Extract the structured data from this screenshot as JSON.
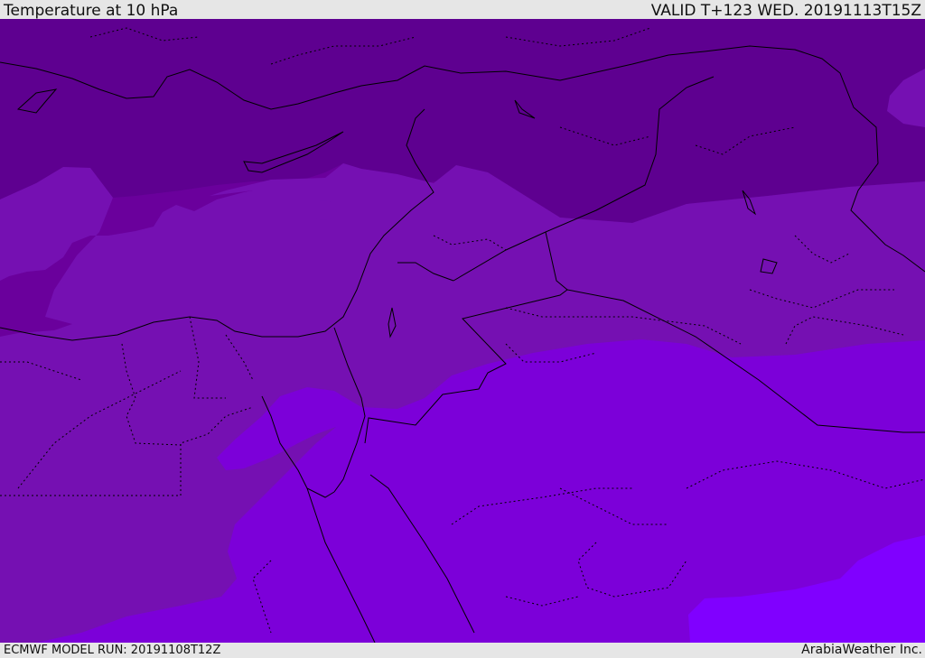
{
  "header": {
    "title": "Temperature at 10 hPa",
    "valid": "VALID T+123 WED. 20191113T15Z"
  },
  "footer": {
    "model_run": "ECMWF MODEL RUN: 20191108T12Z",
    "credit": "ArabiaWeather Inc."
  },
  "map": {
    "colors": {
      "band_darkest": "#5e0090",
      "band_dark": "#6a009c",
      "band_mid": "#7510b2",
      "band_bright": "#7c00d9",
      "band_brightest": "#8000ff",
      "coastline": "#000000"
    }
  }
}
